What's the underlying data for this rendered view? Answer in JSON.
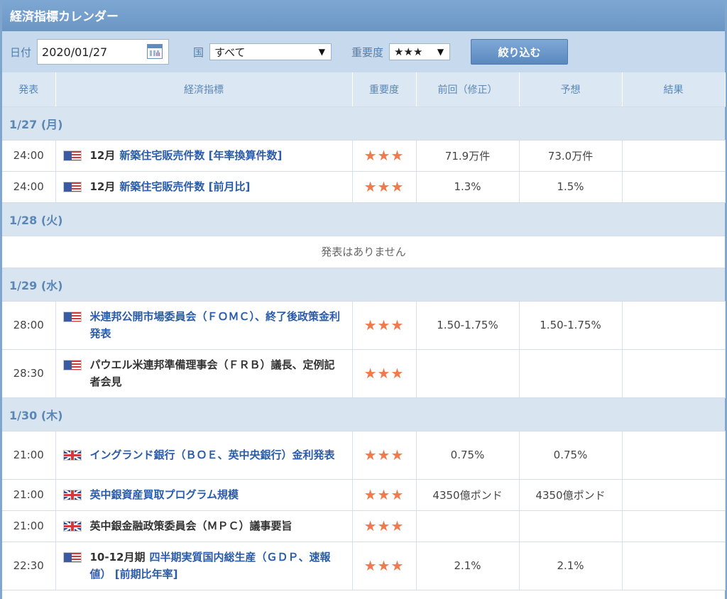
{
  "title": "経済指標カレンダー",
  "filters": {
    "date_label": "日付",
    "date_value": "2020/01/27",
    "country_label": "国",
    "country_value": "すべて",
    "importance_label": "重要度",
    "importance_value": "★★★",
    "filter_button": "絞り込む"
  },
  "columns": [
    "発表",
    "経済指標",
    "重要度",
    "前回（修正）",
    "予想",
    "結果"
  ],
  "days": [
    {
      "label": "1/27 (月)",
      "events": [
        {
          "time": "24:00",
          "flag": "us-flag-icon",
          "month": "12月",
          "title": "新築住宅販売件数 [年率換算件数]",
          "stars": "★★★",
          "prev": "71.9万件",
          "forecast": "73.0万件",
          "result": ""
        },
        {
          "time": "24:00",
          "flag": "us-flag-icon",
          "month": "12月",
          "title": "新築住宅販売件数 [前月比]",
          "stars": "★★★",
          "prev": "1.3%",
          "forecast": "1.5%",
          "result": ""
        }
      ]
    },
    {
      "label": "1/28 (火)",
      "no_data": "発表はありません",
      "events": []
    },
    {
      "label": "1/29 (水)",
      "events": [
        {
          "time": "28:00",
          "flag": "us-flag-icon",
          "month": "",
          "title": "米連邦公開市場委員会（ＦＯＭＣ）、終了後政策金利発表",
          "stars": "★★★",
          "prev": "1.50-1.75%",
          "forecast": "1.50-1.75%",
          "result": ""
        },
        {
          "time": "28:30",
          "flag": "us-flag-icon",
          "month": "",
          "title": "パウエル米連邦準備理事会（ＦＲＢ）議長、定例記者会見",
          "stars": "★★★",
          "prev": "",
          "forecast": "",
          "result": "",
          "dark": true
        }
      ]
    },
    {
      "label": "1/30 (木)",
      "events": [
        {
          "time": "21:00",
          "flag": "uk-flag-icon",
          "month": "",
          "title": "イングランド銀行（ＢＯＥ、英中央銀行）金利発表",
          "stars": "★★★",
          "prev": "0.75%",
          "forecast": "0.75%",
          "result": ""
        },
        {
          "time": "21:00",
          "flag": "uk-flag-icon",
          "month": "",
          "title": "英中銀資産買取プログラム規模",
          "stars": "★★★",
          "prev": "4350億ポンド",
          "forecast": "4350億ポンド",
          "result": ""
        },
        {
          "time": "21:00",
          "flag": "uk-flag-icon",
          "month": "",
          "title": "英中銀金融政策委員会（ＭＰＣ）議事要旨",
          "stars": "★★★",
          "prev": "",
          "forecast": "",
          "result": "",
          "dark": true
        },
        {
          "time": "22:30",
          "flag": "us-flag-icon",
          "month": "10-12月期",
          "title": "四半期実質国内総生産（ＧＤＰ、速報値） [前期比年率]",
          "stars": "★★★",
          "prev": "2.1%",
          "forecast": "2.1%",
          "result": ""
        }
      ]
    }
  ]
}
